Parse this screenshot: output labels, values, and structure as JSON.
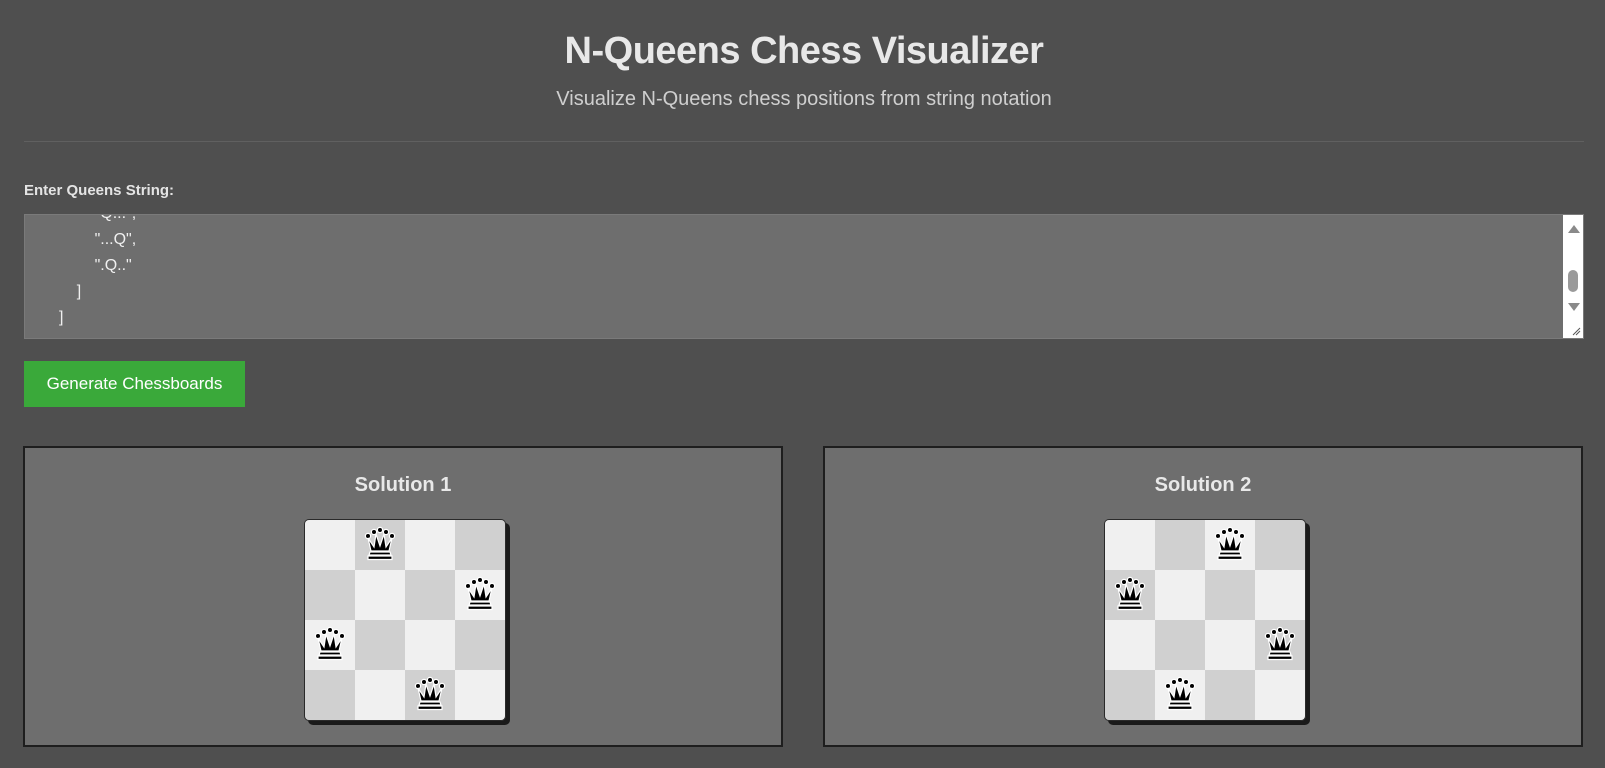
{
  "header": {
    "title": "N-Queens Chess Visualizer",
    "subtitle": "Visualize N-Queens chess positions from string notation"
  },
  "input": {
    "label": "Enter Queens String:",
    "visible_text": "        \"Q...\",\n        \"...Q\",\n        \".Q..\"\n    ]\n]"
  },
  "generate_button": {
    "label": "Generate Chessboards"
  },
  "solutions": [
    {
      "title": "Solution 1",
      "queen_columns": [
        1,
        3,
        0,
        2
      ]
    },
    {
      "title": "Solution 2",
      "queen_columns": [
        2,
        0,
        3,
        1
      ]
    }
  ],
  "colors": {
    "background": "#4f4f4f",
    "panel": "#6e6e6e",
    "button": "#3aa93a",
    "light_square": "#f0f0f0",
    "dark_square": "#d0d0d0",
    "queen": "#000000"
  },
  "icons": {
    "queen": "queen-icon"
  }
}
